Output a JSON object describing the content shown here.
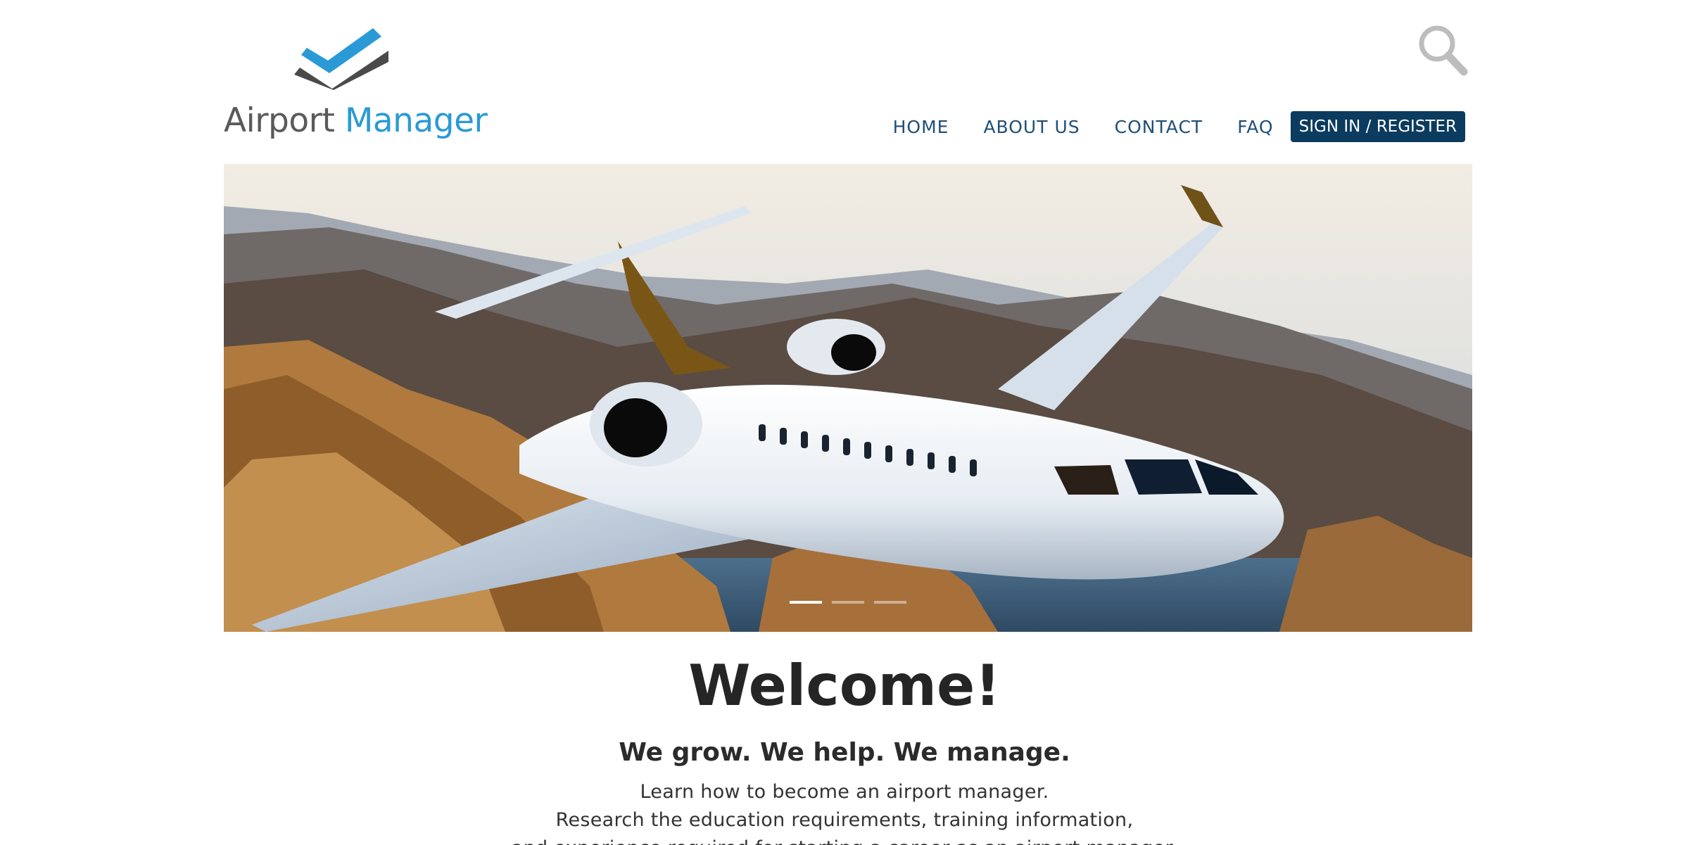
{
  "logo": {
    "word1": "Airport",
    "word2": "Manager",
    "icon": "double-checkmark-logo"
  },
  "header": {
    "search_icon": "search-icon"
  },
  "nav": {
    "items": [
      "HOME",
      "ABOUT US",
      "CONTACT",
      "FAQ"
    ],
    "signin_label": "SIGN IN / REGISTER"
  },
  "hero": {
    "image": "private jet flying over coastal mountains",
    "slides": 3,
    "active_slide": 1
  },
  "main": {
    "heading": "Welcome!",
    "tagline": "We grow. We help. We manage.",
    "lines": [
      "Learn how to become an airport manager.",
      "Research the education requirements, training information,",
      "and experience required for starting a career as an airport manager."
    ]
  },
  "colors": {
    "brand_blue": "#2a9ad6",
    "nav_text": "#1f4f79",
    "button_bg": "#0b3b5e",
    "logo_gray": "#5a5a5a"
  }
}
